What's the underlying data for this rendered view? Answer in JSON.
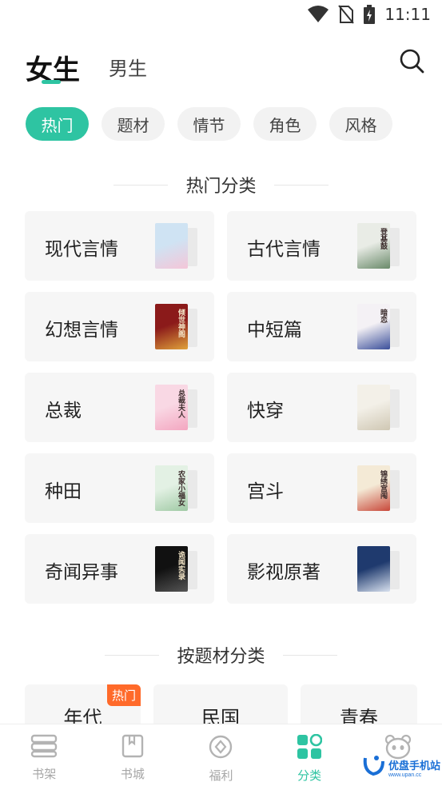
{
  "status_bar": {
    "time": "11:11",
    "icons": [
      "wifi-icon",
      "no-sim-icon",
      "battery-charging-icon"
    ]
  },
  "header": {
    "tabs": [
      {
        "label": "女生",
        "active": true
      },
      {
        "label": "男生",
        "active": false
      }
    ],
    "search_icon": "search-icon"
  },
  "chips": [
    {
      "label": "热门",
      "active": true
    },
    {
      "label": "题材",
      "active": false
    },
    {
      "label": "情节",
      "active": false
    },
    {
      "label": "角色",
      "active": false
    },
    {
      "label": "风格",
      "active": false
    }
  ],
  "hot_section": {
    "title": "热门分类",
    "categories": [
      {
        "label": "现代言情",
        "cover_colors": [
          "#cfe3f3",
          "#f4c6d8"
        ],
        "cover_text": ""
      },
      {
        "label": "古代言情",
        "cover_colors": [
          "#e9ece6",
          "#6a8a6a"
        ],
        "cover_text": "登基鼓"
      },
      {
        "label": "幻想言情",
        "cover_colors": [
          "#8b1a1a",
          "#e0a23a"
        ],
        "cover_text": "倾世神阁"
      },
      {
        "label": "中短篇",
        "cover_colors": [
          "#f4f1f5",
          "#3a4e9a"
        ],
        "cover_text": "暗恋"
      },
      {
        "label": "总裁",
        "cover_colors": [
          "#f9d8e4",
          "#f3a6c0"
        ],
        "cover_text": "总裁夫人"
      },
      {
        "label": "快穿",
        "cover_colors": [
          "#f3f0e8",
          "#cfc7b3"
        ],
        "cover_text": ""
      },
      {
        "label": "种田",
        "cover_colors": [
          "#e3f1e4",
          "#9fc9a4"
        ],
        "cover_text": "农家小福女"
      },
      {
        "label": "宫斗",
        "cover_colors": [
          "#f4ead6",
          "#c8483a"
        ],
        "cover_text": "锦绣宫闱"
      },
      {
        "label": "奇闻异事",
        "cover_colors": [
          "#111111",
          "#555555"
        ],
        "cover_text": "诡闻实录"
      },
      {
        "label": "影视原著",
        "cover_colors": [
          "#1f3a6e",
          "#d7e0ee"
        ],
        "cover_text": ""
      }
    ]
  },
  "topic_section": {
    "title": "按题材分类",
    "topics": [
      {
        "label": "年代",
        "badge": "热门"
      },
      {
        "label": "民国",
        "badge": ""
      },
      {
        "label": "青春",
        "badge": ""
      }
    ]
  },
  "bottom_nav": {
    "items": [
      {
        "label": "书架",
        "icon": "bookshelf-icon",
        "active": false
      },
      {
        "label": "书城",
        "icon": "book-icon",
        "active": false
      },
      {
        "label": "福利",
        "icon": "coin-icon",
        "active": false
      },
      {
        "label": "分类",
        "icon": "category-grid-icon",
        "active": true
      },
      {
        "label": "",
        "icon": "panda-icon",
        "active": false
      }
    ]
  },
  "watermark": {
    "text": "优盘手机站",
    "url_text": "www.upan.cc"
  },
  "colors": {
    "accent": "#2ec4a2",
    "hot_badge": "#ff6a2a",
    "card_bg": "#f6f6f6",
    "chip_bg": "#f2f2f2"
  }
}
